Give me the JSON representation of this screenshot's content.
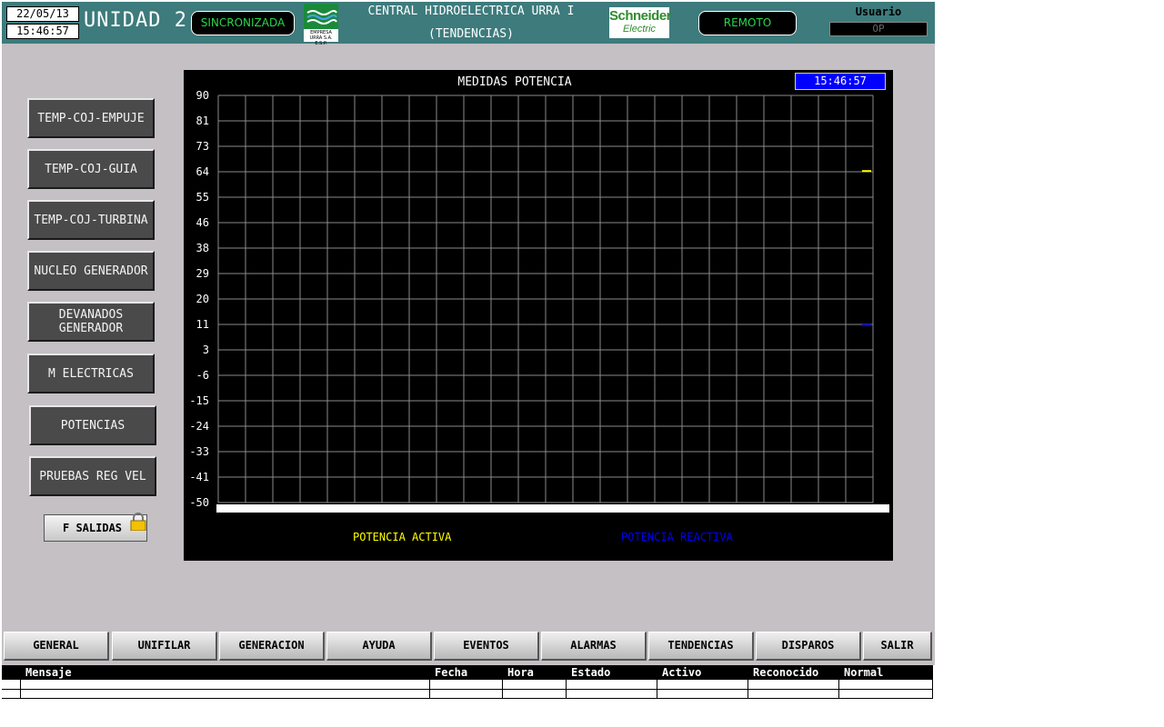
{
  "header": {
    "date": "22/05/13",
    "time": "15:46:57",
    "unit_title": "UNIDAD 2",
    "sync_status": "SINCRONIZADA",
    "plant_name": "CENTRAL HIDROELECTRICA URRA I",
    "screen_name": "(TENDENCIAS)",
    "logo_urra_text_1": "EMPRESA",
    "logo_urra_text_2": "URRA S.A. E.S.P.",
    "logo_schneider_text_1": "Schneider",
    "logo_schneider_text_2": "Electric",
    "mode": "REMOTO",
    "user_label": "Usuario",
    "user_value": "OP"
  },
  "nav": {
    "buttons": [
      {
        "line1": "TEMP-COJ-EMPUJE",
        "line2": ""
      },
      {
        "line1": "TEMP-COJ-GUIA",
        "line2": ""
      },
      {
        "line1": "TEMP-COJ-TURBINA",
        "line2": ""
      },
      {
        "line1": "NUCLEO GENERADOR",
        "line2": ""
      },
      {
        "line1": "DEVANADOS",
        "line2": "GENERADOR"
      },
      {
        "line1": "M ELECTRICAS",
        "line2": ""
      },
      {
        "line1": "POTENCIAS",
        "line2": ""
      },
      {
        "line1": "PRUEBAS REG VEL",
        "line2": ""
      }
    ],
    "fsalidas": "F SALIDAS"
  },
  "chart": {
    "title": "MEDIDAS POTENCIA",
    "timestamp": "15:46:57",
    "legend_active": "POTENCIA ACTIVA",
    "legend_reactive": "POTENCIA REACTIVA",
    "color_active": "#ffff00",
    "color_reactive": "#0000ff"
  },
  "chart_data": {
    "type": "line",
    "title": "MEDIDAS POTENCIA",
    "xlabel": "",
    "ylabel": "",
    "ylim": [
      -50,
      90
    ],
    "ytick_labels": [
      "90",
      "81",
      "73",
      "64",
      "55",
      "46",
      "38",
      "29",
      "20",
      "11",
      "3",
      "-6",
      "-15",
      "-24",
      "-33",
      "-41",
      "-50"
    ],
    "grid": true,
    "series": [
      {
        "name": "POTENCIA ACTIVA",
        "color": "#ffff00",
        "values": [
          64,
          64
        ]
      },
      {
        "name": "POTENCIA REACTIVA",
        "color": "#0000ff",
        "values": [
          11,
          11
        ]
      }
    ]
  },
  "tabs": [
    "GENERAL",
    "UNIFILAR",
    "GENERACION",
    "AYUDA",
    "EVENTOS",
    "ALARMAS",
    "TENDENCIAS",
    "DISPAROS",
    "SALIR"
  ],
  "alarm_table": {
    "columns": [
      "Mensaje",
      "Fecha",
      "Hora",
      "Estado",
      "Activo",
      "Reconocido",
      "Normal"
    ]
  }
}
